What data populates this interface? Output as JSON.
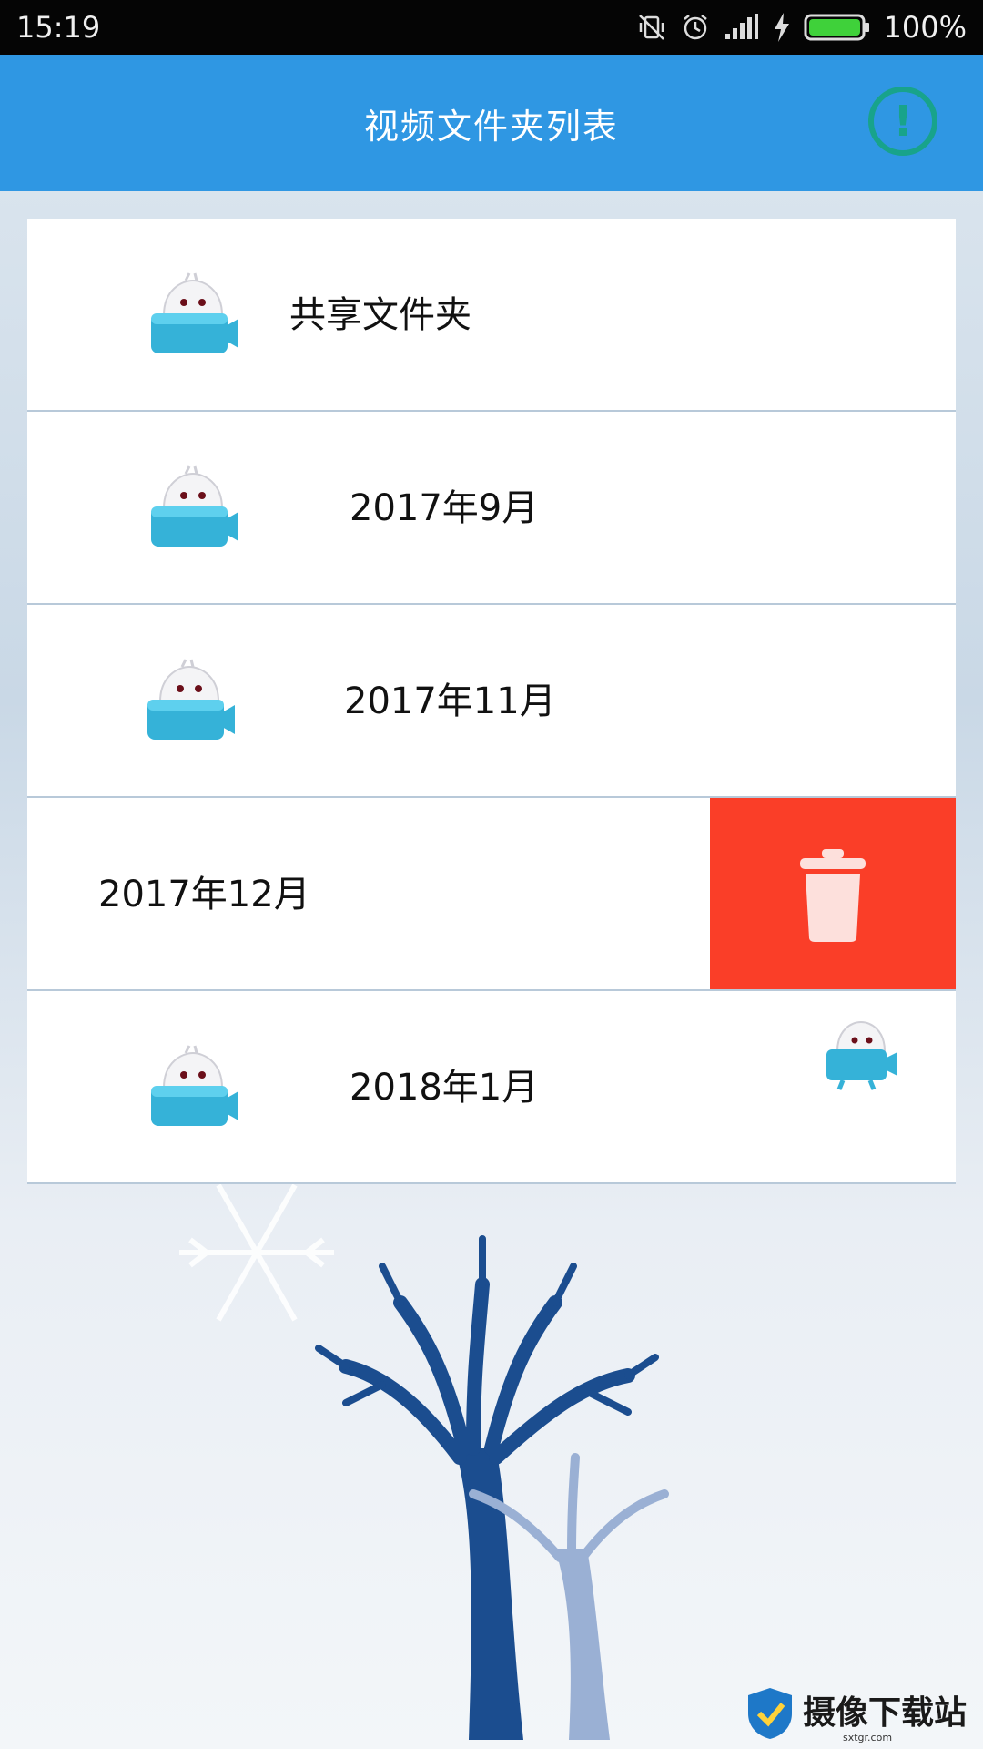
{
  "status_bar": {
    "time": "15:19",
    "battery_percent": "100%",
    "icons": [
      "vibrate-off-icon",
      "alarm-icon",
      "signal-icon",
      "charging-icon",
      "battery-icon"
    ]
  },
  "app_bar": {
    "title": "视频文件夹列表",
    "info_icon": "info-exclamation-icon",
    "info_color": "#18a38b",
    "background": "#2f97e3"
  },
  "folders": [
    {
      "label": "共享文件夹",
      "icon": "video-camera-mascot-icon"
    },
    {
      "label": "2017年9月",
      "icon": "video-camera-mascot-icon"
    },
    {
      "label": "2017年11月",
      "icon": "video-camera-mascot-icon"
    },
    {
      "label": "2017年12月",
      "icon": "video-camera-mascot-icon",
      "swiped": true,
      "action_icon": "trash-icon",
      "action_color": "#fa3e28"
    },
    {
      "label": "2018年1月",
      "icon": "video-camera-mascot-icon"
    }
  ],
  "watermark": {
    "text": "摄像下载站",
    "sub": "sxtgr.com"
  }
}
